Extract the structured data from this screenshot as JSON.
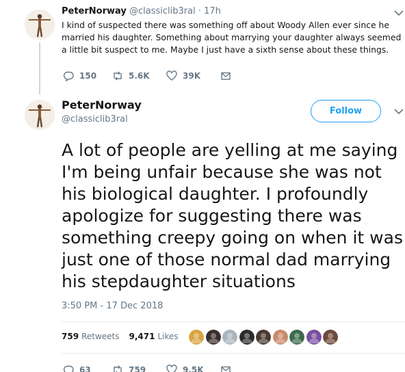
{
  "tweet1": {
    "name": "PeterNorway",
    "handle": "@classiclib3ral",
    "separator": "·",
    "time": "17h",
    "text": "I kind of suspected there was something off about Woody Allen ever since he married his daughter. Something about marrying your daughter always seemed a little bit suspect to me. Maybe I just have a sixth sense about these things.",
    "replies": "150",
    "retweets": "5.6K",
    "likes": "39K"
  },
  "tweet2": {
    "name": "PeterNorway",
    "handle": "@classiclib3ral",
    "follow_label": "Follow",
    "text": "A lot of people are yelling at me saying I'm being unfair because she was not his biological daughter. I profoundly apologize for suggesting there was something creepy going on when it was just one of those normal dad marrying his stepdaughter situations",
    "timestamp": "3:50 PM - 17 Dec 2018",
    "retweet_count": "759",
    "retweet_label": "Retweets",
    "like_count": "9,471",
    "like_label": "Likes",
    "replies": "63",
    "retweets": "759",
    "likes": "9.5K"
  },
  "colors": {
    "accent": "#1da1f2",
    "secondary_text": "#657786",
    "divider": "#e6ecf0"
  },
  "liker_avatars": [
    "#d9a441",
    "#3a2e2a",
    "#aab4bd",
    "#2b2b2b",
    "#4a3a30",
    "#c98b6b",
    "#3b6b4a",
    "#7a4fa0",
    "#6d4a3a"
  ]
}
